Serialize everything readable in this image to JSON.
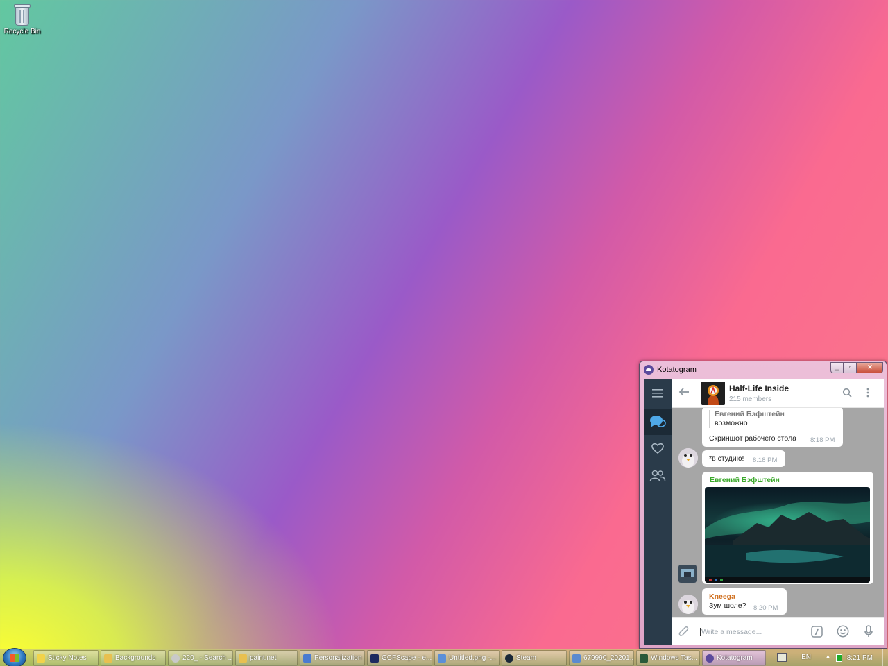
{
  "desktop": {
    "icons": [
      {
        "label": "Recycle Bin",
        "icon": "recycle-bin-icon"
      }
    ]
  },
  "window": {
    "title": "Kotatogram",
    "controls": {
      "minimize": "▁",
      "maximize": "▫",
      "close": "✕"
    }
  },
  "chat": {
    "name": "Half-Life Inside",
    "members": "215 members",
    "messages": [
      {
        "reply_name": "Евгений Бэфштейн",
        "reply_text": "возможно",
        "text": "Скриншот рабочего стола",
        "time": "8:18 PM"
      },
      {
        "text": "*в студию!",
        "time": "8:18 PM"
      },
      {
        "sender": "Евгений Бэфштейн",
        "sender_color": "#3aa82a",
        "media": "photo"
      },
      {
        "sender": "Kneega",
        "sender_color": "#d07020",
        "text": "Зум шоле?",
        "time": "8:20 PM"
      }
    ],
    "composer_placeholder": "Write a message..."
  },
  "taskbar": {
    "buttons": [
      {
        "label": "Sticky Notes",
        "color": "#f2d34a"
      },
      {
        "label": "Backgrounds",
        "color": "#e8c050"
      },
      {
        "label": "220_ - Search ...",
        "color": "#c9c9c9"
      },
      {
        "label": "paint.net",
        "color": "#e8c050"
      },
      {
        "label": "Personalization",
        "color": "#4a7bd0"
      },
      {
        "label": "GCFScape - e...",
        "color": "#1e2a60"
      },
      {
        "label": "Untitled.png -...",
        "color": "#5b8fd8"
      },
      {
        "label": "Steam",
        "color": "#1b2838"
      },
      {
        "label": "679990_20201...",
        "color": "#5a8ad0"
      },
      {
        "label": "Windows Tas...",
        "color": "#2a5a3a"
      },
      {
        "label": "Kotatogram",
        "color": "#5b4a9c"
      }
    ],
    "tray": {
      "language": "EN",
      "time": "8:21 PM"
    }
  }
}
